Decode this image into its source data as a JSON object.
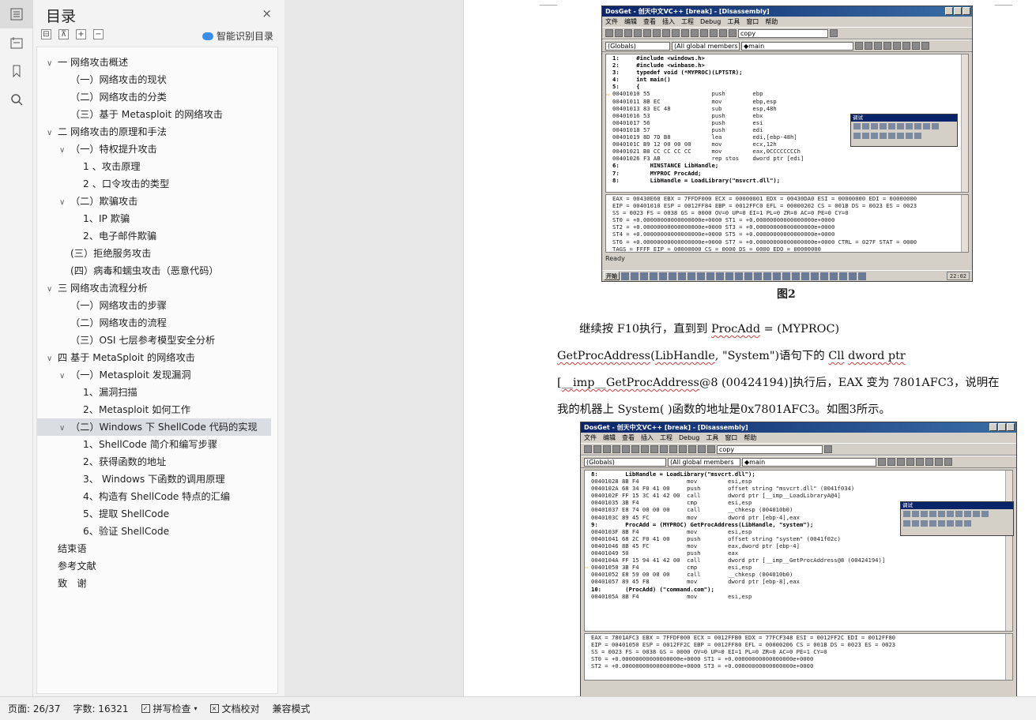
{
  "rail": {
    "icons": [
      "toc-icon",
      "template-icon",
      "bookmark-icon",
      "search-icon"
    ]
  },
  "toc": {
    "title": "目录",
    "close": "×",
    "tools": [
      "⊟",
      "⊼",
      "+",
      "−"
    ],
    "smart_label": "智能识别目录",
    "items": [
      {
        "text": "一 网络攻击概述",
        "level": 0,
        "caret": "∨"
      },
      {
        "text": "（一）网络攻击的现状",
        "level": 1,
        "caret": ""
      },
      {
        "text": "（二）网络攻击的分类",
        "level": 1,
        "caret": ""
      },
      {
        "text": "（三）基于 Metasploit 的网络攻击",
        "level": 1,
        "caret": ""
      },
      {
        "text": "二 网络攻击的原理和手法",
        "level": 0,
        "caret": "∨"
      },
      {
        "text": "（一）特权提升攻击",
        "level": 1,
        "caret": "∨"
      },
      {
        "text": "1 、攻击原理",
        "level": 2,
        "caret": ""
      },
      {
        "text": "2 、口令攻击的类型",
        "level": 2,
        "caret": ""
      },
      {
        "text": "（二）欺骗攻击",
        "level": 1,
        "caret": "∨"
      },
      {
        "text": "1、IP 欺骗",
        "level": 2,
        "caret": ""
      },
      {
        "text": "2、电子邮件欺骗",
        "level": 2,
        "caret": ""
      },
      {
        "text": "(三）拒绝服务攻击",
        "level": 1,
        "caret": ""
      },
      {
        "text": "(四）病毒和蠕虫攻击（恶意代码）",
        "level": 1,
        "caret": ""
      },
      {
        "text": "三 网络攻击流程分析",
        "level": 0,
        "caret": "∨"
      },
      {
        "text": "（一）网络攻击的步骤",
        "level": 1,
        "caret": ""
      },
      {
        "text": "（二）网络攻击的流程",
        "level": 1,
        "caret": ""
      },
      {
        "text": "（三）OSI 七层参考模型安全分析",
        "level": 1,
        "caret": ""
      },
      {
        "text": "四 基于 MetaSploit 的网络攻击",
        "level": 0,
        "caret": "∨"
      },
      {
        "text": "（一）Metasploit 发现漏洞",
        "level": 1,
        "caret": "∨"
      },
      {
        "text": "1、漏洞扫描",
        "level": 2,
        "caret": ""
      },
      {
        "text": "2、Metasploit 如何工作",
        "level": 2,
        "caret": ""
      },
      {
        "text": "（二）Windows 下 ShellCode 代码的实现",
        "level": 1,
        "caret": "∨"
      },
      {
        "text": "1、ShellCode 简介和编写步骤",
        "level": 2,
        "caret": ""
      },
      {
        "text": "2、获得函数的地址",
        "level": 2,
        "caret": ""
      },
      {
        "text": "3、 Windows 下函数的调用原理",
        "level": 2,
        "caret": ""
      },
      {
        "text": "4、构造有 ShellCode 特点的汇编",
        "level": 2,
        "caret": ""
      },
      {
        "text": "5、提取 ShellCode",
        "level": 2,
        "caret": ""
      },
      {
        "text": "6、验证 ShellCode",
        "level": 2,
        "caret": ""
      },
      {
        "text": "结束语",
        "level": -1,
        "caret": ""
      },
      {
        "text": "参考文献",
        "level": -1,
        "caret": ""
      },
      {
        "text": "致　谢",
        "level": -1,
        "caret": ""
      }
    ],
    "selected_index": 21
  },
  "status": {
    "page": "页面: 26/37",
    "words": "字数: 16321",
    "spell": "拼写检查",
    "proof": "文档校对",
    "compat": "兼容模式"
  },
  "document": {
    "caption2": "图2",
    "paragraph": {
      "p1": "继续按 F10执行，直到到 ",
      "s1": "ProcAdd",
      "p2": " = (MYPROC) ",
      "s2": "GetProcAddress",
      "p3": "(",
      "s3": "LibHandle",
      "p4": ", \"System\")语句下的 ",
      "s4": "Cll",
      "p5": " ",
      "s5": "dword ptr",
      "p6": " [",
      "s6": "__imp__GetProcAddress",
      "p7": "@8 (00424194)]执行后，EAX 变为 7801AFC3，说明在我的机器上 System( )函数的地址是0x7801AFC3。如图3所示。"
    },
    "shot1": {
      "title": "DosGet - 创天中文VC++ [break] - [Disassembly]",
      "menu": [
        "文件",
        "编辑",
        "查看",
        "插入",
        "工程",
        "Debug",
        "工具",
        "窗口",
        "帮助"
      ],
      "combo_find": "copy",
      "combo_globals": "(Globals)",
      "combo_members": "(All global members",
      "combo_main": "◆main",
      "code": [
        {
          "t": "1:     #include <windows.h>",
          "src": true
        },
        {
          "t": "2:     #include <winbase.h>",
          "src": true
        },
        {
          "t": "3:     typedef void (*MYPROC)(LPTSTR);",
          "src": true
        },
        {
          "t": "4:     int main()",
          "src": true
        },
        {
          "t": "5:     {",
          "src": true
        },
        {
          "t": "00401010 55                  push        ebp",
          "src": false,
          "arrow": true
        },
        {
          "t": "00401011 8B EC               mov         ebp,esp",
          "src": false
        },
        {
          "t": "00401013 83 EC 48            sub         esp,48h",
          "src": false
        },
        {
          "t": "00401016 53                  push        ebx",
          "src": false
        },
        {
          "t": "00401017 56                  push        esi",
          "src": false
        },
        {
          "t": "00401018 57                  push        edi",
          "src": false
        },
        {
          "t": "00401019 8D 7D B8            lea         edi,[ebp-48h]",
          "src": false
        },
        {
          "t": "0040101C B9 12 00 00 00      mov         ecx,12h",
          "src": false
        },
        {
          "t": "00401021 B8 CC CC CC CC      mov         eax,0CCCCCCCCh",
          "src": false
        },
        {
          "t": "00401026 F3 AB               rep stos    dword ptr [edi]",
          "src": false
        },
        {
          "t": "6:         HINSTANCE LibHandle;",
          "src": true
        },
        {
          "t": "7:         MYPROC ProcAdd;",
          "src": true
        },
        {
          "t": "8:         LibHandle = LoadLibrary(\"msvcrt.dll\");",
          "src": true
        }
      ],
      "regs": [
        "EAX = 00430E60 EBX = 7FFDF000 ECX = 00000001 EDX = 00430DA0 ESI = 00000000 EDI = 00000000",
        "EIP = 00401010 ESP = 0012FF84 EBP = 0012FFC0 EFL = 00000202 CS = 001B DS = 0023 ES = 0023",
        "SS = 0023 FS = 0038 GS = 0000 OV=0 UP=0 EI=1 PL=0 ZR=0 AC=0 PE=0 CY=0",
        "ST0 = +0.00000000000000000e+0000 ST1 = +0.00000000000000000e+0000",
        "ST2 = +0.00000000000000000e+0000 ST3 = +0.00000000000000000e+0000",
        "ST4 = +0.00000000000000000e+0000 ST5 = +0.00000000000000000e+0000",
        "ST6 = +0.00000000000000000e+0000 ST7 = +0.00000000000000000e+0000 CTRL = 027F STAT = 0000",
        "TAGS = FFFF EIP = 00000000 CS = 0000 DS = 0000 EDO = 00000000"
      ],
      "float_title": "调试",
      "ready": "Ready",
      "start": "开始",
      "clock": "22:02"
    },
    "shot2": {
      "title": "DosGet - 创天中文VC++ [break] - [Disassembly]",
      "menu": [
        "文件",
        "编辑",
        "查看",
        "插入",
        "工程",
        "Debug",
        "工具",
        "窗口",
        "帮助"
      ],
      "combo_find": "copy",
      "combo_globals": "(Globals)",
      "combo_members": "(All global members",
      "combo_main": "◆main",
      "code": [
        {
          "t": "8:        LibHandle = LoadLibrary(\"msvcrt.dll\");",
          "src": true
        },
        {
          "t": "00401028 8B F4              mov         esi,esp",
          "src": false
        },
        {
          "t": "0040102A 68 34 F0 41 00     push        offset string \"msvcrt.dll\" (0041f034)",
          "src": false
        },
        {
          "t": "0040102F FF 15 3C 41 42 00  call        dword ptr [__imp__LoadLibraryA@4]",
          "src": false
        },
        {
          "t": "00401035 3B F4              cmp         esi,esp",
          "src": false
        },
        {
          "t": "00401037 E8 74 00 00 00     call        __chkesp (004010b0)",
          "src": false
        },
        {
          "t": "0040103C 89 45 FC           mov         dword ptr [ebp-4],eax",
          "src": false
        },
        {
          "t": "9:        ProcAdd = (MYPROC) GetProcAddress(LibHandle, \"system\");",
          "src": true
        },
        {
          "t": "0040103F 8B F4              mov         esi,esp",
          "src": false
        },
        {
          "t": "00401041 68 2C F0 41 00     push        offset string \"system\" (0041f02c)",
          "src": false
        },
        {
          "t": "00401046 8B 45 FC           mov         eax,dword ptr [ebp-4]",
          "src": false
        },
        {
          "t": "00401049 50                 push        eax",
          "src": false
        },
        {
          "t": "0040104A FF 15 94 41 42 00  call        dword ptr [__imp__GetProcAddress@8 (00424194)]",
          "src": false
        },
        {
          "t": "00401050 3B F4              cmp         esi,esp",
          "src": false,
          "arrow": true
        },
        {
          "t": "00401052 E8 59 00 00 00     call        __chkesp (004010b0)",
          "src": false
        },
        {
          "t": "00401057 89 45 F8           mov         dword ptr [ebp-8],eax",
          "src": false
        },
        {
          "t": "10:       (ProcAdd) (\"command.com\");",
          "src": true
        },
        {
          "t": "0040105A 8B F4              mov         esi,esp",
          "src": false
        }
      ],
      "regs": [
        "EAX = 7801AFC3 EBX = 7FFDF000 ECX = 0012FFB0 EDX = 77FCF348 ESI = 0012FF2C EDI = 0012FF80",
        "EIP = 00401050 ESP = 0012FF2C EBP = 0012FF80 EFL = 00000206 CS = 001B DS = 0023 ES = 0023",
        "SS = 0023 FS = 0038 GS = 0000 OV=0 UP=0 EI=1 PL=0 ZR=0 AC=0 PE=1 CY=0",
        "ST0 = +0.00000000000000000e+0000 ST1 = +0.00000000000000000e+0000",
        "ST2 = +0.00000000000000000e+0000 ST3 = +0.00000000000000000e+0000"
      ],
      "float_title": "调试"
    }
  }
}
